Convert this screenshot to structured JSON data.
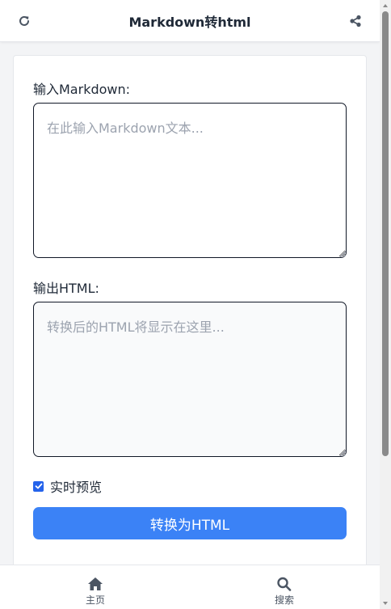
{
  "header": {
    "title": "Markdown转html",
    "left_icon": "refresh-icon",
    "right_icon": "share-icon"
  },
  "editor": {
    "markdown_label": "输入Markdown:",
    "markdown_placeholder": "在此输入Markdown文本...",
    "markdown_value": "",
    "html_label": "输出HTML:",
    "html_placeholder": "转换后的HTML将显示在这里...",
    "html_value": "",
    "live_preview_label": "实时预览",
    "live_preview_checked": true,
    "convert_button": "转换为HTML"
  },
  "bottom_nav": {
    "items": [
      {
        "label": "主页",
        "icon": "home-icon"
      },
      {
        "label": "搜索",
        "icon": "search-icon"
      }
    ]
  },
  "colors": {
    "primary": "#3b82f6",
    "checkbox": "#2563eb",
    "title_text": "#1f2937",
    "icon_gray": "#4b5563"
  }
}
